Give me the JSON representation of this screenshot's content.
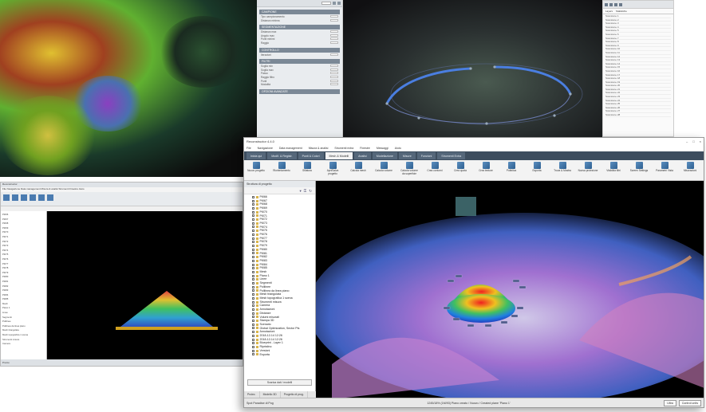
{
  "top_settings": {
    "sections": [
      {
        "label": "CAMPIONE",
        "rows": [
          "Tipo campionamento",
          "Distanza minima"
        ]
      },
      {
        "label": "SEGMENTAZIONE",
        "rows": [
          "Distanza max",
          "Angolo max",
          "Punti minimi",
          "Raggio"
        ]
      },
      {
        "label": "CONTROLLO",
        "rows": [
          "Iterazioni"
        ]
      },
      {
        "label": "FILTRI",
        "rows": [
          "Soglia min",
          "Soglia max",
          "Passo",
          "Raggio filtro",
          "Punti",
          "Modalità"
        ]
      },
      {
        "label": "OPZIONI AVANZATE",
        "rows": []
      }
    ]
  },
  "top_list": {
    "tabs": [
      "Layers",
      "Statistiche"
    ],
    "items": [
      "Scansione 1",
      "Scansione 2",
      "Scansione 3",
      "Scansione 4",
      "Scansione 5",
      "Scansione 6",
      "Scansione 7",
      "Scansione 8",
      "Scansione 9",
      "Scansione 10",
      "Scansione 11",
      "Scansione 12",
      "Scansione 13",
      "Scansione 14",
      "Scansione 15",
      "Scansione 16",
      "Scansione 17",
      "Scansione 18",
      "Scansione 19",
      "Scansione 20",
      "Scansione 21",
      "Scansione 22",
      "Scansione 23",
      "Scansione 24",
      "Scansione 25",
      "Scansione 26",
      "Scansione 27",
      "Scansione 28"
    ]
  },
  "small_app": {
    "title": "Reconstructor",
    "menu": "File  Navigazione  Data management  Misura & analisi  Strumenti  Finestre  Aiuto",
    "status": "Pronto"
  },
  "main_app": {
    "title": "Reconstructor 4.4.0",
    "window_controls": [
      "–",
      "□",
      "×"
    ],
    "menu": [
      "File",
      "Navigazione",
      "Data management",
      "Misura & analisi",
      "Strumenti extra",
      "Finestre",
      "Messaggi",
      "Aiuto"
    ],
    "tabs": [
      "Inizia qui",
      "Modif. & Registr.",
      "Punti & Colori",
      "Mesh & Modelli",
      "Analisi",
      "Modellazione",
      "Misure",
      "Funzioni",
      "Strumenti Extra"
    ],
    "active_tab": 3,
    "ribbon": [
      "Nuovo progetto",
      "Riorientamento",
      "Sfilatura",
      "Apri/Salva progetto",
      "Calcola mesh",
      "Calcola volume",
      "Calcola volume da superficie",
      "Crea contorni",
      "Crea quota",
      "Crea texture",
      "Pubblica",
      "Esporta",
      "Trova & Mostra",
      "Nuova proiezione",
      "Visibilità filtri",
      "Screen Settings",
      "Parametri Vista",
      "Misurazioni"
    ],
    "side_header": "Struttura di progetto",
    "tree": [
      "Pt066",
      "Pt067",
      "Pt068",
      "Pt069",
      "Pt070",
      "Pt071",
      "Pt072",
      "Pt073",
      "Pt074",
      "Pt075",
      "Pt076",
      "Pt077",
      "Pt078",
      "Pt079",
      "Pt080",
      "Pt081",
      "Pt082",
      "Pt083",
      "Pt084",
      "Pt085",
      "Mesh",
      "Piano 1",
      "Linee",
      "Segmenti",
      "Polilinee",
      "Polilinea da linea piano",
      "Mesh triangolata",
      "Mesh topografica 1 scena",
      "Strumenti misura",
      "Camera",
      "Annotazioni",
      "Distanze",
      "Volumi misurati",
      "Stampa 3D",
      "Scenario",
      "Global Optimization, Sector Pts",
      "Annotazioni",
      "2018-12-14 12:26",
      "2018-12-14 12:26",
      "Blueprint - Layer 1",
      "Ripristino",
      "Versioni",
      "Esporta"
    ],
    "side_button": "Scarica dati / modelli",
    "bottom_tabs": [
      "Proiez.",
      "Modello 3D",
      "Progetto di prog."
    ],
    "status_left": "Spot Paradise di Pog",
    "status_mid": "1245/18%  (1M/93)  Piano creato / Nuovo / Created plane 'Piano 1'",
    "status_right": [
      "Ultra",
      "Control units"
    ]
  },
  "colors": {
    "tab_bar": "#3d4d5e",
    "active_tab": "#f3f3f3",
    "viewport": "#000000",
    "section": "#7b8896"
  }
}
